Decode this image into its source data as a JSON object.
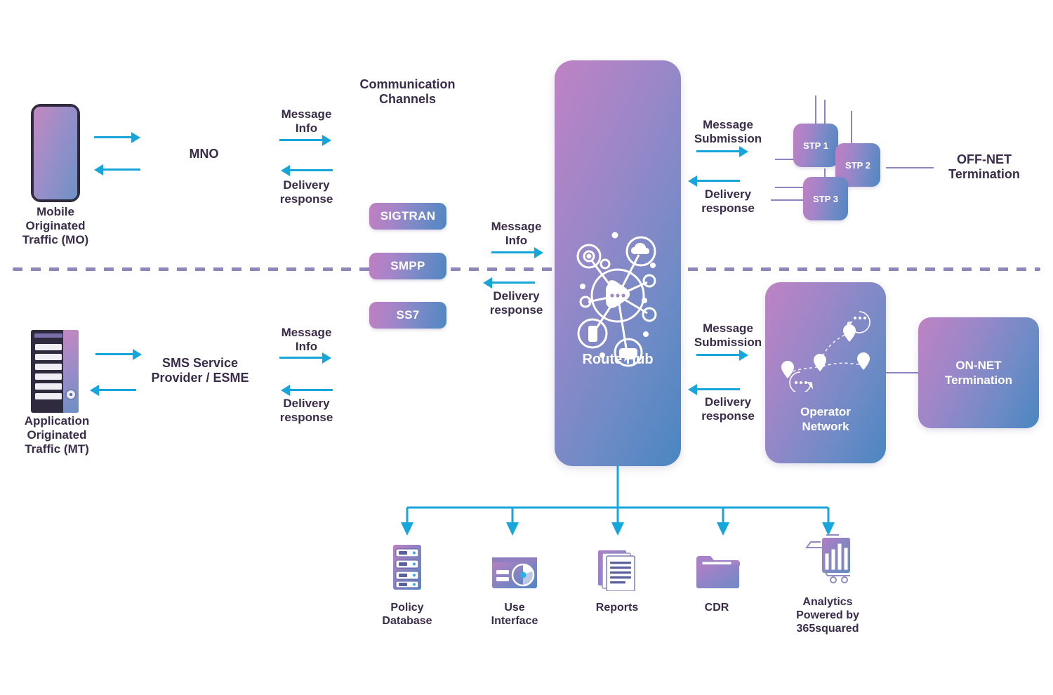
{
  "theme": {
    "arrow_color": "#17a6dc",
    "text_color": "#3a2c4a",
    "gradient_start": "#c07fc2",
    "gradient_end": "#4f87c2",
    "divider_color": "#8f87bb",
    "background": "#ffffff"
  },
  "left": {
    "mo": {
      "icon": "smartphone-icon",
      "caption": "Mobile\nOriginated\nTraffic (MO)",
      "caption_lines": [
        "Mobile",
        "Originated",
        "Traffic (MO)"
      ],
      "network_label": "MNO"
    },
    "mt": {
      "icon": "server-rack-icon",
      "caption_lines": [
        "Application",
        "Originated",
        "Traffic (MT)"
      ],
      "network_label": "SMS Service\nProvider / ESME",
      "network_label_lines": [
        "SMS Service",
        "Provider / ESME"
      ]
    }
  },
  "channels": {
    "title_lines": [
      "Communication",
      "Channels"
    ],
    "items": [
      {
        "label": "SIGTRAN"
      },
      {
        "label": "SMPP"
      },
      {
        "label": "SS7"
      }
    ]
  },
  "flows": {
    "mo_out": {
      "label_lines": [
        "Message",
        "Info"
      ],
      "direction": "right"
    },
    "mo_in": {
      "label_lines": [
        "Delivery",
        "response"
      ],
      "direction": "left"
    },
    "mt_out": {
      "label_lines": [
        "Message",
        "Info"
      ],
      "direction": "right"
    },
    "mt_in": {
      "label_lines": [
        "Delivery",
        "response"
      ],
      "direction": "left"
    },
    "hub_in_top": {
      "label_lines": [
        "Message",
        "Info"
      ],
      "direction": "right"
    },
    "hub_out_top": {
      "label_lines": [
        "Delivery",
        "response"
      ],
      "direction": "left"
    },
    "hub_sub_top": {
      "label_lines": [
        "Message",
        "Submission"
      ],
      "direction": "right"
    },
    "hub_resp_top": {
      "label_lines": [
        "Delivery",
        "response"
      ],
      "direction": "left"
    },
    "hub_sub_bottom": {
      "label_lines": [
        "Message",
        "Submission"
      ],
      "direction": "right"
    },
    "hub_resp_bottom": {
      "label_lines": [
        "Delivery",
        "response"
      ],
      "direction": "left"
    }
  },
  "hub": {
    "title": "Route Hub",
    "icon": "network-hub-icon",
    "node_icons": [
      "cloud-icon",
      "target-icon",
      "smartphone-node-icon",
      "chat-bubble-icon",
      "play-icon"
    ]
  },
  "right": {
    "stp": [
      {
        "label": "STP 1"
      },
      {
        "label": "STP 2"
      },
      {
        "label": "STP 3"
      }
    ],
    "offnet": {
      "lines": [
        "OFF-NET",
        "Termination"
      ]
    },
    "operator_network": {
      "lines": [
        "Operator",
        "Network"
      ],
      "icon": "map-pins-icon"
    },
    "onnet": {
      "lines": [
        "ON-NET",
        "Termination"
      ]
    }
  },
  "outputs": [
    {
      "icon": "policy-database-icon",
      "lines": [
        "Policy",
        "Database"
      ]
    },
    {
      "icon": "user-interface-icon",
      "lines": [
        "Use",
        "Interface"
      ]
    },
    {
      "icon": "reports-icon",
      "lines": [
        "Reports"
      ]
    },
    {
      "icon": "cdr-folder-icon",
      "lines": [
        "CDR"
      ]
    },
    {
      "icon": "analytics-icon",
      "lines": [
        "Analytics",
        "Powered by",
        "365squared"
      ]
    }
  ]
}
